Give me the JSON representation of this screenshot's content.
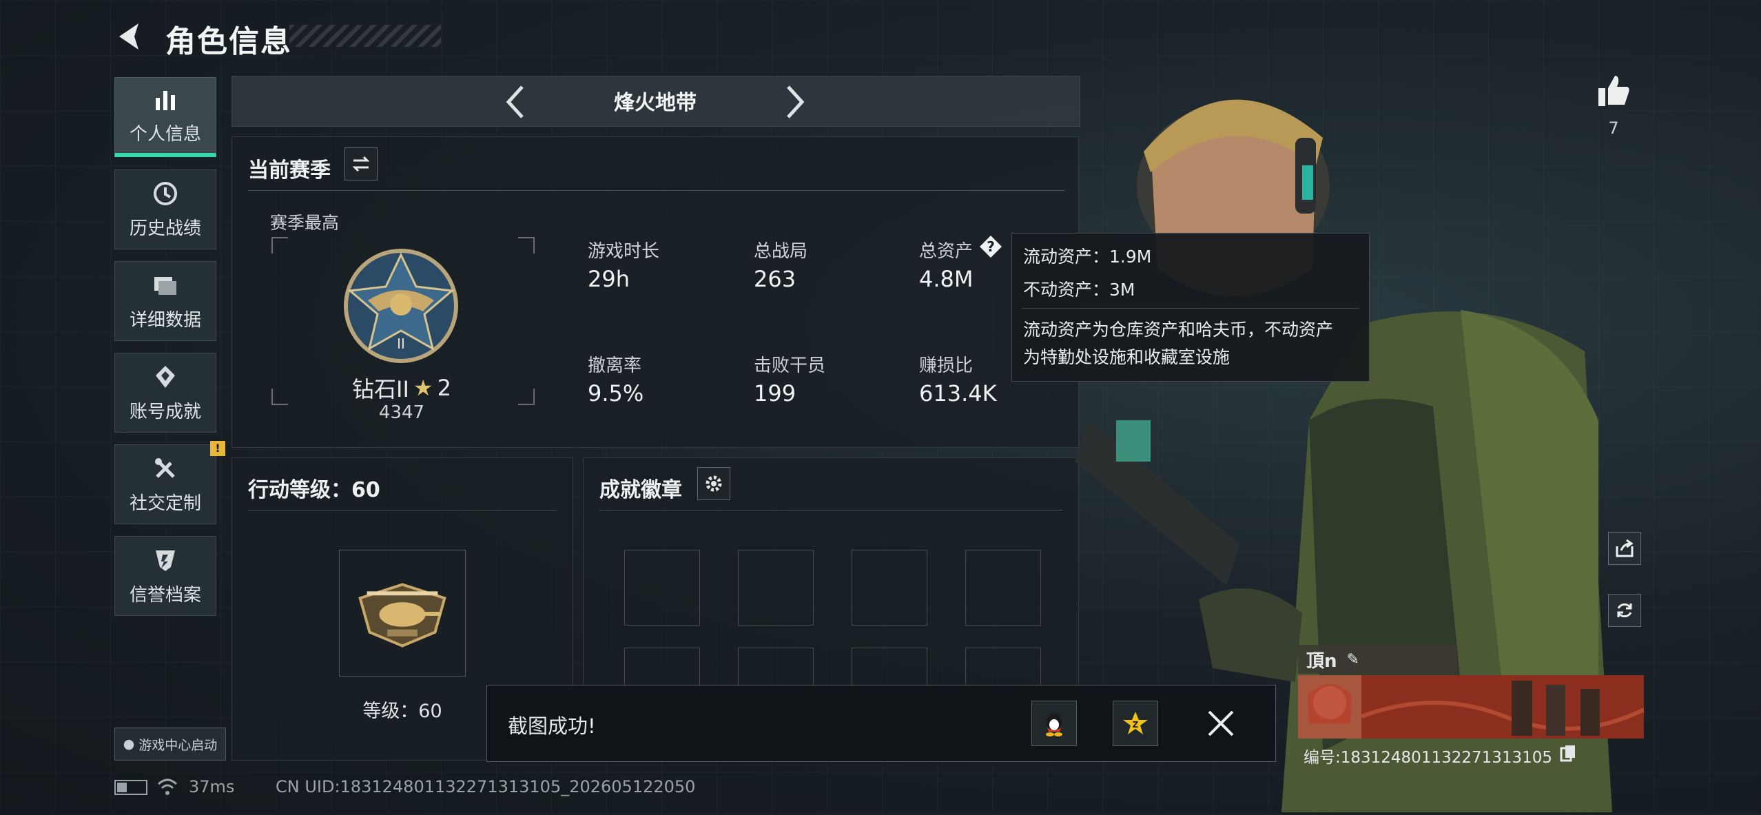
{
  "header": {
    "title": "角色信息"
  },
  "sidebar": {
    "items": [
      {
        "label": "个人信息",
        "icon": "bar-chart-icon",
        "active": true
      },
      {
        "label": "历史战绩",
        "icon": "clock-icon"
      },
      {
        "label": "详细数据",
        "icon": "folder-icon"
      },
      {
        "label": "账号成就",
        "icon": "achievement-icon"
      },
      {
        "label": "社交定制",
        "icon": "tools-icon",
        "badge": "!"
      },
      {
        "label": "信誉档案",
        "icon": "shield-icon"
      }
    ],
    "launch_label": "游戏中心启动"
  },
  "mode": {
    "name": "烽火地带"
  },
  "season": {
    "title": "当前赛季",
    "best_label": "赛季最高",
    "rank_name": "钻石II",
    "rank_stars": "2",
    "rank_score": "4347",
    "stats": [
      {
        "label": "游戏时长",
        "value": "29h"
      },
      {
        "label": "总战局",
        "value": "263"
      },
      {
        "label": "总资产",
        "value": "4.8M"
      },
      {
        "label": "撤离率",
        "value": "9.5%"
      },
      {
        "label": "击败干员",
        "value": "199"
      },
      {
        "label": "赚损比",
        "value": "613.4K"
      }
    ]
  },
  "tooltip": {
    "liquid": "流动资产：1.9M",
    "fixed": "不动资产：3M",
    "desc_line1": "流动资产为仓库资产和哈夫币，不动资产",
    "desc_line2": "为特勤处设施和收藏室设施"
  },
  "action_level": {
    "title": "行动等级：60",
    "level_label": "等级：60"
  },
  "badges": {
    "title": "成就徽章"
  },
  "toast": {
    "message": "截图成功!"
  },
  "likes": {
    "count": "7"
  },
  "player": {
    "name": "頂n",
    "id_text": "编号:183124801132271313105"
  },
  "status_bar": {
    "ping": "37ms",
    "uid": "CN UID:183124801132271313105_202605122050"
  },
  "colors": {
    "accent": "#38d9a9",
    "badge": "#e8b73a"
  }
}
